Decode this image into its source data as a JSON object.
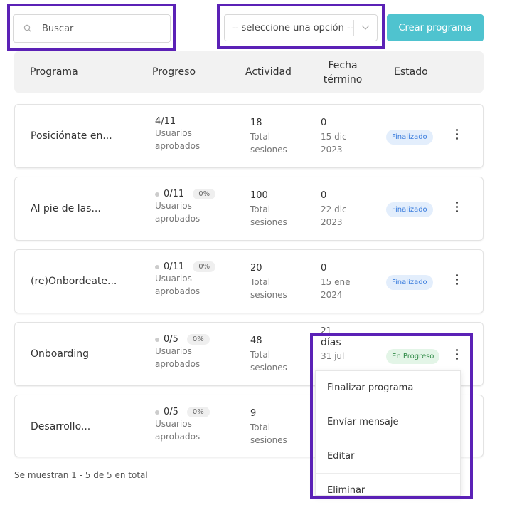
{
  "search": {
    "placeholder": "Buscar"
  },
  "filter": {
    "selected": "-- seleccione una opción --"
  },
  "create_button": "Crear programa",
  "columns": [
    "Programa",
    "Progreso",
    "Actividad",
    "Fecha",
    "término",
    "Estado"
  ],
  "rows": [
    {
      "name": "Posiciónate en...",
      "progress": "4/11",
      "progress_sub1": "Usuarios",
      "progress_sub2": "aprobados",
      "activity": "18",
      "activity_sub1": "Total",
      "activity_sub2": "sesiones",
      "days": "0",
      "date1": "15 dic",
      "date2": "2023",
      "status": "Finalizado"
    },
    {
      "name": "Al pie de las...",
      "progress": "0/11",
      "pct": "0%",
      "progress_sub1": "Usuarios",
      "progress_sub2": "aprobados",
      "activity": "100",
      "activity_sub1": "Total",
      "activity_sub2": "sesiones",
      "days": "0",
      "date1": "22 dic",
      "date2": "2023",
      "status": "Finalizado"
    },
    {
      "name": "(re)Onbordeate...",
      "progress": "0/11",
      "pct": "0%",
      "progress_sub1": "Usuarios",
      "progress_sub2": "aprobados",
      "activity": "20",
      "activity_sub1": "Total",
      "activity_sub2": "sesiones",
      "days": "0",
      "date1": "15 ene",
      "date2": "2024",
      "status": "Finalizado"
    },
    {
      "name": "Onboarding",
      "progress": "0/5",
      "pct": "0%",
      "progress_sub1": "Usuarios",
      "progress_sub2": "aprobados",
      "activity": "48",
      "activity_sub1": "Total",
      "activity_sub2": "sesiones",
      "days_num": "21",
      "days": "días",
      "date1": "31 jul",
      "status": "En Progreso"
    },
    {
      "name": "Desarrollo...",
      "progress": "0/5",
      "pct": "0%",
      "progress_sub1": "Usuarios",
      "progress_sub2": "aprobados",
      "activity": "9",
      "activity_sub1": "Total",
      "activity_sub2": "sesiones"
    }
  ],
  "footer": "Se muestran 1 - 5 de 5 en total",
  "menu": [
    "Finalizar programa",
    "Envíar mensaje",
    "Editar",
    "Eliminar"
  ],
  "colors": {
    "accent": "#4fc3cf",
    "highlight": "#5b21b6",
    "finalizado_bg": "#e3eefc",
    "en_progreso_bg": "#e3f5e7"
  }
}
